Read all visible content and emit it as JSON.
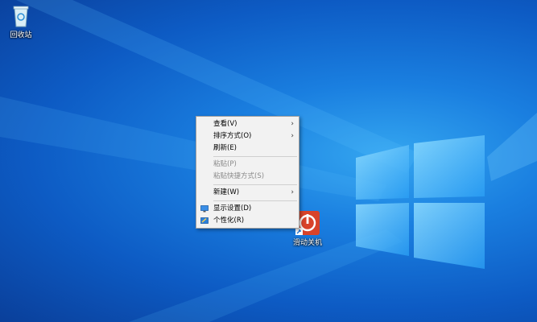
{
  "desktop": {
    "icons": [
      {
        "name": "recycle-bin",
        "label": "回收站",
        "icon": "recycle-bin-icon"
      },
      {
        "name": "shutdown-shortcut",
        "label": "滑动关机",
        "icon": "power-icon"
      }
    ]
  },
  "context_menu": {
    "items": [
      {
        "label": "查看(V)",
        "has_submenu": true
      },
      {
        "label": "排序方式(O)",
        "has_submenu": true
      },
      {
        "label": "刷新(E)"
      },
      {
        "label": "粘贴(P)",
        "disabled": true
      },
      {
        "label": "粘贴快捷方式(S)",
        "disabled": true
      },
      {
        "label": "新建(W)",
        "has_submenu": true
      },
      {
        "label": "显示设置(D)",
        "icon": "display-icon"
      },
      {
        "label": "个性化(R)",
        "icon": "personalize-icon"
      }
    ]
  },
  "colors": {
    "wallpaper": "#1a7fe0",
    "menu_bg": "#f2f2f2",
    "power_tile": "#d8432a"
  }
}
